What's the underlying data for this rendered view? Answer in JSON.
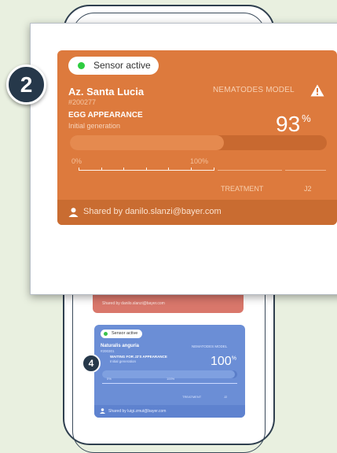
{
  "main_card": {
    "sensor_status": "Sensor active",
    "location": "Az. Santa Lucia",
    "location_id": "#200277",
    "stage": "EGG APPEARANCE",
    "generation": "Initial generation",
    "model": "NEMATODES MODEL",
    "percent_value": "93",
    "percent_unit": "%",
    "progress": 0.6,
    "axis_start": "0%",
    "axis_end": "100%",
    "phase_treatment": "TREATMENT",
    "phase_j2": "J2",
    "shared_by": "Shared by danilo.slanzi@bayer.com"
  },
  "step_badge_large": "2",
  "background_red_card": {
    "shared_by": "Shared by danilo.slanzi@bayer.com"
  },
  "background_blue_card": {
    "sensor_status": "Sensor active",
    "location": "Naturalis anguria",
    "location_id": "#200301",
    "stage": "WAITING FOR J2'S APPEARANCE",
    "generation": "Initial generation",
    "model": "NEMATODES MODEL",
    "percent_value": "100",
    "percent_unit": "%",
    "progress": 0.98,
    "axis_start": "0%",
    "axis_end": "100%",
    "phase_treatment": "TREATMENT",
    "phase_j2": "J2",
    "shared_by": "Shared by luigi.zmut@bayer.com"
  },
  "step_badge_small": "4",
  "colors": {
    "orange_card": "#dd7a3d",
    "blue_card": "#6b8ed6",
    "red_card": "#d9776b",
    "badge": "#26384a",
    "sensor_dot": "#2ecc40"
  },
  "icons": [
    "warning-icon",
    "person-icon",
    "status-dot"
  ]
}
